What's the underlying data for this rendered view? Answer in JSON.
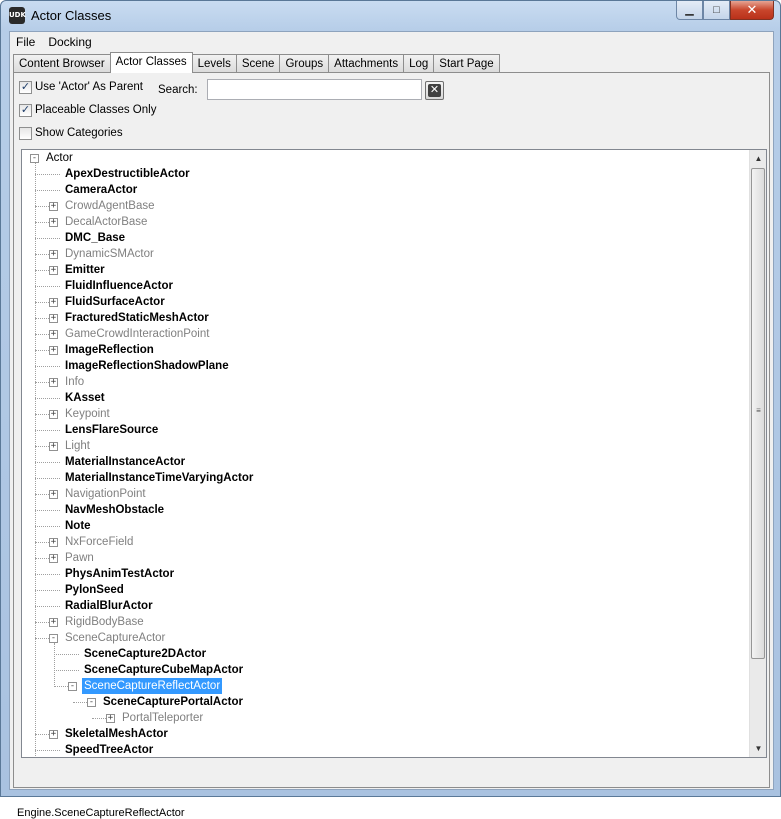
{
  "window": {
    "title": "Actor Classes",
    "app_icon_text": "UDK"
  },
  "caption_buttons": {
    "minimize": "▁",
    "maximize": "□",
    "close": "✕"
  },
  "menu": [
    {
      "label": "File"
    },
    {
      "label": "Docking"
    }
  ],
  "tabs": [
    {
      "label": "Content Browser",
      "active": false
    },
    {
      "label": "Actor Classes",
      "active": true
    },
    {
      "label": "Levels",
      "active": false
    },
    {
      "label": "Scene",
      "active": false
    },
    {
      "label": "Groups",
      "active": false
    },
    {
      "label": "Attachments",
      "active": false
    },
    {
      "label": "Log",
      "active": false
    },
    {
      "label": "Start Page",
      "active": false
    }
  ],
  "options": {
    "use_actor_parent": {
      "label": "Use 'Actor' As Parent",
      "checked": true
    },
    "placeable_only": {
      "label": "Placeable Classes Only",
      "checked": true
    },
    "show_categories": {
      "label": "Show Categories",
      "checked": false
    }
  },
  "search": {
    "label": "Search:",
    "value": "",
    "placeholder": ""
  },
  "tree": [
    {
      "label": "Actor",
      "depth": 0,
      "style": "root",
      "expander": "-"
    },
    {
      "label": "ApexDestructibleActor",
      "depth": 1,
      "style": "bold",
      "expander": ""
    },
    {
      "label": "CameraActor",
      "depth": 1,
      "style": "bold",
      "expander": ""
    },
    {
      "label": "CrowdAgentBase",
      "depth": 1,
      "style": "gray",
      "expander": "+"
    },
    {
      "label": "DecalActorBase",
      "depth": 1,
      "style": "gray",
      "expander": "+"
    },
    {
      "label": "DMC_Base",
      "depth": 1,
      "style": "bold",
      "expander": ""
    },
    {
      "label": "DynamicSMActor",
      "depth": 1,
      "style": "gray",
      "expander": "+"
    },
    {
      "label": "Emitter",
      "depth": 1,
      "style": "bold",
      "expander": "+"
    },
    {
      "label": "FluidInfluenceActor",
      "depth": 1,
      "style": "bold",
      "expander": ""
    },
    {
      "label": "FluidSurfaceActor",
      "depth": 1,
      "style": "bold",
      "expander": "+"
    },
    {
      "label": "FracturedStaticMeshActor",
      "depth": 1,
      "style": "bold",
      "expander": "+"
    },
    {
      "label": "GameCrowdInteractionPoint",
      "depth": 1,
      "style": "gray",
      "expander": "+"
    },
    {
      "label": "ImageReflection",
      "depth": 1,
      "style": "bold",
      "expander": "+"
    },
    {
      "label": "ImageReflectionShadowPlane",
      "depth": 1,
      "style": "bold",
      "expander": ""
    },
    {
      "label": "Info",
      "depth": 1,
      "style": "gray",
      "expander": "+"
    },
    {
      "label": "KAsset",
      "depth": 1,
      "style": "bold",
      "expander": ""
    },
    {
      "label": "Keypoint",
      "depth": 1,
      "style": "gray",
      "expander": "+"
    },
    {
      "label": "LensFlareSource",
      "depth": 1,
      "style": "bold",
      "expander": ""
    },
    {
      "label": "Light",
      "depth": 1,
      "style": "gray",
      "expander": "+"
    },
    {
      "label": "MaterialInstanceActor",
      "depth": 1,
      "style": "bold",
      "expander": ""
    },
    {
      "label": "MaterialInstanceTimeVaryingActor",
      "depth": 1,
      "style": "bold",
      "expander": ""
    },
    {
      "label": "NavigationPoint",
      "depth": 1,
      "style": "gray",
      "expander": "+"
    },
    {
      "label": "NavMeshObstacle",
      "depth": 1,
      "style": "bold",
      "expander": ""
    },
    {
      "label": "Note",
      "depth": 1,
      "style": "bold",
      "expander": ""
    },
    {
      "label": "NxForceField",
      "depth": 1,
      "style": "gray",
      "expander": "+"
    },
    {
      "label": "Pawn",
      "depth": 1,
      "style": "gray",
      "expander": "+"
    },
    {
      "label": "PhysAnimTestActor",
      "depth": 1,
      "style": "bold",
      "expander": ""
    },
    {
      "label": "PylonSeed",
      "depth": 1,
      "style": "bold",
      "expander": ""
    },
    {
      "label": "RadialBlurActor",
      "depth": 1,
      "style": "bold",
      "expander": ""
    },
    {
      "label": "RigidBodyBase",
      "depth": 1,
      "style": "gray",
      "expander": "+"
    },
    {
      "label": "SceneCaptureActor",
      "depth": 1,
      "style": "gray",
      "expander": "-"
    },
    {
      "label": "SceneCapture2DActor",
      "depth": 2,
      "style": "bold",
      "expander": ""
    },
    {
      "label": "SceneCaptureCubeMapActor",
      "depth": 2,
      "style": "bold",
      "expander": ""
    },
    {
      "label": "SceneCaptureReflectActor",
      "depth": 2,
      "style": "selected",
      "expander": "-"
    },
    {
      "label": "SceneCapturePortalActor",
      "depth": 3,
      "style": "bold",
      "expander": "-"
    },
    {
      "label": "PortalTeleporter",
      "depth": 4,
      "style": "gray",
      "expander": "+"
    },
    {
      "label": "SkeletalMeshActor",
      "depth": 1,
      "style": "bold",
      "expander": "+"
    },
    {
      "label": "SpeedTreeActor",
      "depth": 1,
      "style": "bold",
      "expander": ""
    }
  ],
  "scrollbar": {
    "up_arrow": "▲",
    "down_arrow": "▼",
    "grip": "≡"
  },
  "status": {
    "text": "Engine.SceneCaptureReflectActor"
  },
  "colors": {
    "selection": "#3399ff",
    "gray_text": "#808080"
  }
}
